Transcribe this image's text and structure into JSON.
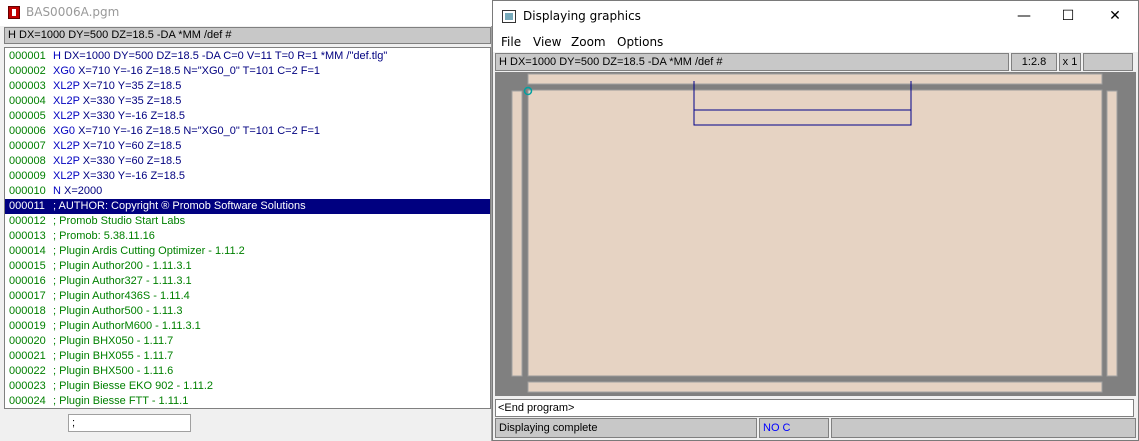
{
  "left_window": {
    "title": "BAS0006A.pgm",
    "header": "H DX=1000 DY=500 DZ=18.5 -DA *MM /def #",
    "command_input": ";",
    "lines": [
      {
        "num": "000001",
        "cmd": "H",
        "rest": " DX=1000 DY=500 DZ=18.5 -DA C=0 V=11 T=0 R=1 *MM /\"def.tlg\"",
        "type": "code"
      },
      {
        "num": "000002",
        "cmd": "XG0",
        "rest": " X=710 Y=-16 Z=18.5 N=\"XG0_0\" T=101 C=2 F=1",
        "type": "code"
      },
      {
        "num": "000003",
        "cmd": "XL2P",
        "rest": " X=710 Y=35 Z=18.5",
        "type": "code"
      },
      {
        "num": "000004",
        "cmd": "XL2P",
        "rest": " X=330 Y=35 Z=18.5",
        "type": "code"
      },
      {
        "num": "000005",
        "cmd": "XL2P",
        "rest": " X=330 Y=-16 Z=18.5",
        "type": "code"
      },
      {
        "num": "000006",
        "cmd": "XG0",
        "rest": " X=710 Y=-16 Z=18.5 N=\"XG0_0\" T=101 C=2 F=1",
        "type": "code"
      },
      {
        "num": "000007",
        "cmd": "XL2P",
        "rest": " X=710 Y=60 Z=18.5",
        "type": "code"
      },
      {
        "num": "000008",
        "cmd": "XL2P",
        "rest": " X=330 Y=60 Z=18.5",
        "type": "code"
      },
      {
        "num": "000009",
        "cmd": "XL2P",
        "rest": " X=330 Y=-16 Z=18.5",
        "type": "code"
      },
      {
        "num": "000010",
        "cmd": "N",
        "rest": " X=2000",
        "type": "code"
      },
      {
        "num": "000011",
        "cmd": "",
        "rest": "; AUTHOR: Copyright ® Promob Software Solutions",
        "type": "selected"
      },
      {
        "num": "000012",
        "cmd": "",
        "rest": "; Promob Studio Start Labs",
        "type": "comment"
      },
      {
        "num": "000013",
        "cmd": "",
        "rest": "; Promob: 5.38.11.16",
        "type": "comment"
      },
      {
        "num": "000014",
        "cmd": "",
        "rest": "; Plugin Ardis Cutting Optimizer - 1.11.2",
        "type": "comment"
      },
      {
        "num": "000015",
        "cmd": "",
        "rest": "; Plugin Author200 - 1.11.3.1",
        "type": "comment"
      },
      {
        "num": "000016",
        "cmd": "",
        "rest": "; Plugin Author327 - 1.11.3.1",
        "type": "comment"
      },
      {
        "num": "000017",
        "cmd": "",
        "rest": "; Plugin Author436S - 1.11.4",
        "type": "comment"
      },
      {
        "num": "000018",
        "cmd": "",
        "rest": "; Plugin Author500 - 1.11.3",
        "type": "comment"
      },
      {
        "num": "000019",
        "cmd": "",
        "rest": "; Plugin AuthorM600 - 1.11.3.1",
        "type": "comment"
      },
      {
        "num": "000020",
        "cmd": "",
        "rest": "; Plugin BHX050 - 1.11.7",
        "type": "comment"
      },
      {
        "num": "000021",
        "cmd": "",
        "rest": "; Plugin BHX055 - 1.11.7",
        "type": "comment"
      },
      {
        "num": "000022",
        "cmd": "",
        "rest": "; Plugin BHX500 - 1.11.6",
        "type": "comment"
      },
      {
        "num": "000023",
        "cmd": "",
        "rest": "; Plugin Biesse EKO 902 - 1.11.2",
        "type": "comment"
      },
      {
        "num": "000024",
        "cmd": "",
        "rest": "; Plugin Biesse FTT - 1.11.1",
        "type": "comment"
      }
    ]
  },
  "right_window": {
    "title": "Displaying graphics",
    "controls": {
      "minimize": "—",
      "maximize": "☐",
      "close": "✕"
    },
    "menu": [
      "File",
      "View",
      "Zoom",
      "Options"
    ],
    "status_top": "H DX=1000 DY=500 DZ=18.5 -DA *MM /def #",
    "zoom_ratio": "1:2.8",
    "zoom_multiplier": "x 1",
    "message": "<End program>",
    "status_bottom": "Displaying complete",
    "mode": "NO C",
    "colors": {
      "panel": "#e6d3c3",
      "frame": "#808080",
      "toolpath": "#00008b",
      "origin": "#00a0a0"
    }
  }
}
